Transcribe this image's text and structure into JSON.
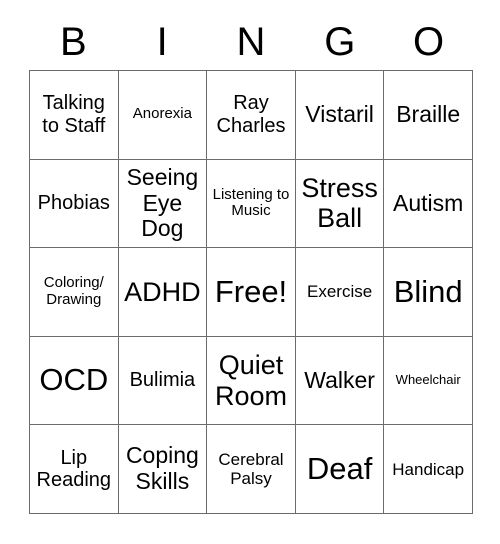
{
  "card": {
    "type": "bingo-card",
    "columns": 5,
    "rows": 5,
    "header": {
      "letters": [
        "B",
        "I",
        "N",
        "G",
        "O"
      ]
    },
    "cells": [
      [
        {
          "text": "Talking to Staff",
          "size": "lg"
        },
        {
          "text": "Anorexia",
          "size": "sm"
        },
        {
          "text": "Ray Charles",
          "size": "lg"
        },
        {
          "text": "Vistaril",
          "size": "xl"
        },
        {
          "text": "Braille",
          "size": "xl"
        }
      ],
      [
        {
          "text": "Phobias",
          "size": "lg"
        },
        {
          "text": "Seeing Eye Dog",
          "size": "xl"
        },
        {
          "text": "Listening to Music",
          "size": "sm"
        },
        {
          "text": "Stress Ball",
          "size": "2xl"
        },
        {
          "text": "Autism",
          "size": "xl"
        }
      ],
      [
        {
          "text": "Coloring/ Drawing",
          "size": "sm"
        },
        {
          "text": "ADHD",
          "size": "2xl"
        },
        {
          "text": "Free!",
          "size": "3xl"
        },
        {
          "text": "Exercise",
          "size": "md"
        },
        {
          "text": "Blind",
          "size": "3xl"
        }
      ],
      [
        {
          "text": "OCD",
          "size": "3xl"
        },
        {
          "text": "Bulimia",
          "size": "lg"
        },
        {
          "text": "Quiet Room",
          "size": "2xl"
        },
        {
          "text": "Walker",
          "size": "xl"
        },
        {
          "text": "Wheelchair",
          "size": "xs"
        }
      ],
      [
        {
          "text": "Lip Reading",
          "size": "lg"
        },
        {
          "text": "Coping Skills",
          "size": "xl"
        },
        {
          "text": "Cerebral Palsy",
          "size": "md"
        },
        {
          "text": "Deaf",
          "size": "3xl"
        },
        {
          "text": "Handicap",
          "size": "md"
        }
      ]
    ],
    "colors": {
      "background": "#ffffff",
      "text": "#000000",
      "grid_line": "#6b6b6b"
    }
  }
}
